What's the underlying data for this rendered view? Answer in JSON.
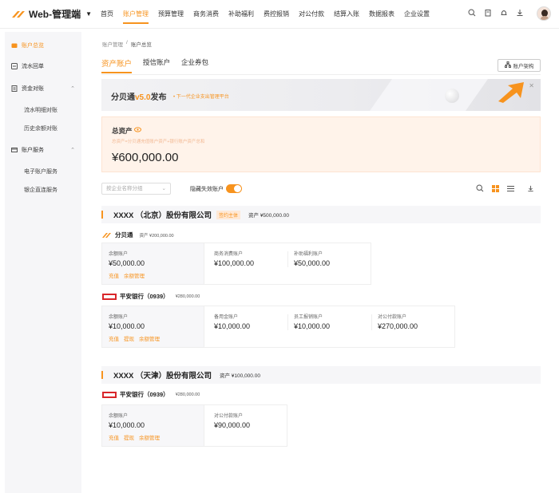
{
  "app": {
    "title": "Web-管理端"
  },
  "nav": {
    "items": [
      "首页",
      "账户管理",
      "预算管理",
      "商务消费",
      "补助福利",
      "费控报销",
      "对公付款",
      "结算入账",
      "数据报表",
      "企业设置"
    ],
    "active": 1
  },
  "sidebar": {
    "items": [
      {
        "label": "账户总览",
        "active": true
      },
      {
        "label": "流水回单"
      },
      {
        "label": "资金对账"
      },
      {
        "label": "流水明细对账"
      },
      {
        "label": "历史余额对账"
      },
      {
        "label": "账户服务"
      },
      {
        "label": "电子账户服务"
      },
      {
        "label": "银企直连服务"
      }
    ]
  },
  "breadcrumb": {
    "parent": "账户管理",
    "sep": "/",
    "current": "账户总览"
  },
  "tabs": {
    "items": [
      "资产账户",
      "授信账户",
      "企业券包"
    ]
  },
  "arch_button": {
    "label": "账户架构"
  },
  "banner": {
    "title_prefix": "分贝通",
    "version": "v5.0",
    "title_suffix": "发布",
    "sub": "• 下一代企业支出管理平台"
  },
  "total": {
    "label": "总资产",
    "desc": "总资产=分贝通充值账户资产+银行账户资产总和",
    "amount": "¥600,000.00"
  },
  "filter": {
    "placeholder": "按企业名称分组"
  },
  "hide_invalid": {
    "label": "隐藏失效账户",
    "on": true
  },
  "companies": [
    {
      "name": "XXXX （北京）股份有限公司",
      "tag": "签约主体",
      "assets": "资产 ¥500,000.00",
      "providers": [
        {
          "name": "分贝通",
          "asset": "资产 ¥200,000.00",
          "accounts": [
            {
              "title": "余额账户",
              "value": "¥50,000.00",
              "links": [
                "充值",
                "余额管理"
              ]
            },
            {
              "title": "商务消费账户",
              "value": "¥100,000.00"
            },
            {
              "title": "补助福利账户",
              "value": "¥50,000.00"
            }
          ]
        },
        {
          "name": "平安银行（0939）",
          "asset": "¥280,000.00",
          "accounts": [
            {
              "title": "余额账户",
              "value": "¥10,000.00",
              "links": [
                "充值",
                "提现",
                "余额管理"
              ]
            },
            {
              "title": "备用金账户",
              "value": "¥10,000.00"
            },
            {
              "title": "员工报销账户",
              "value": "¥10,000.00"
            },
            {
              "title": "对公付款账户",
              "value": "¥270,000.00"
            }
          ]
        }
      ]
    },
    {
      "name": "XXXX （天津）股份有限公司",
      "assets": "资产 ¥100,000.00",
      "providers": [
        {
          "name": "平安银行（0939）",
          "asset": "¥280,000.00",
          "accounts": [
            {
              "title": "余额账户",
              "value": "¥10,000.00",
              "links": [
                "充值",
                "提现",
                "余额管理"
              ]
            },
            {
              "title": "对公付款账户",
              "value": "¥90,000.00"
            }
          ]
        }
      ]
    }
  ],
  "colors": {
    "accent": "#f7931e",
    "sidebar_bg": "#f6f6f8",
    "total_bg": "#fff3ea"
  },
  "icons": [
    "search-icon",
    "clipboard-icon",
    "bell-icon",
    "download-icon",
    "eye-icon",
    "grid-view-icon",
    "list-view-icon",
    "close-icon",
    "org-chart-icon"
  ]
}
